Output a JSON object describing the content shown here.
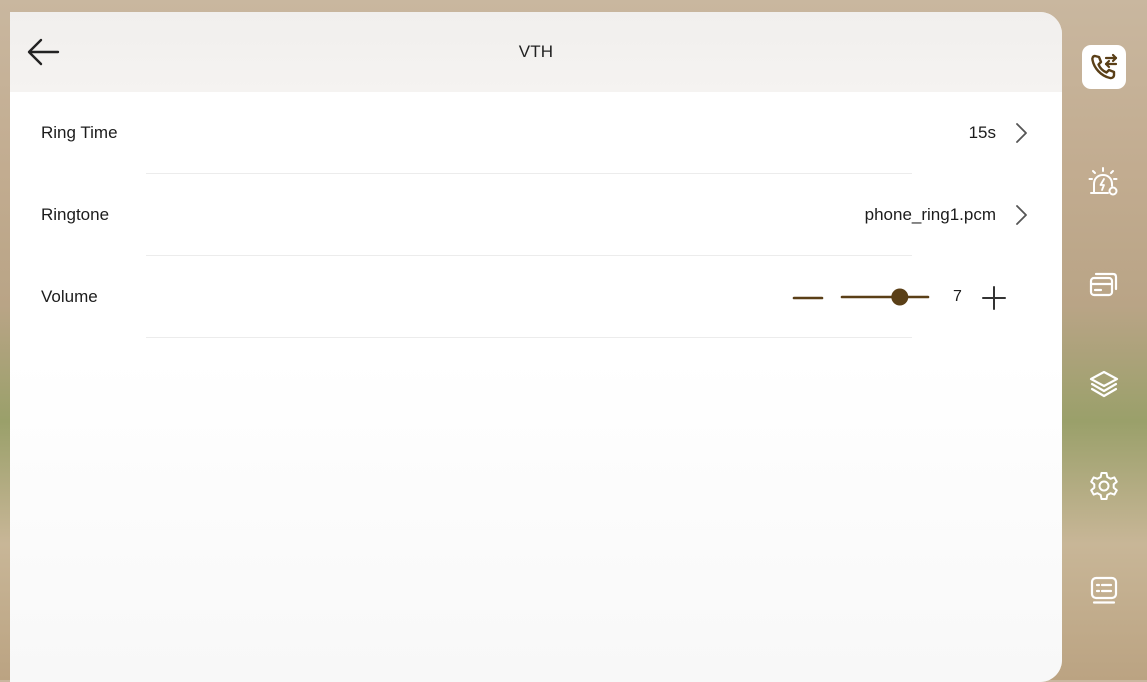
{
  "header": {
    "title": "VTH"
  },
  "settings": {
    "ring_time": {
      "label": "Ring Time",
      "value": "15s"
    },
    "ringtone": {
      "label": "Ringtone",
      "value": "phone_ring1.pcm"
    },
    "volume": {
      "label": "Volume",
      "value": "7",
      "level": 7,
      "max": 10
    }
  },
  "sidebar": {
    "items": [
      {
        "icon": "call-transfer-icon",
        "active": true
      },
      {
        "icon": "alarm-settings-icon",
        "active": false
      },
      {
        "icon": "card-icon",
        "active": false
      },
      {
        "icon": "layers-icon",
        "active": false
      },
      {
        "icon": "gear-icon",
        "active": false
      },
      {
        "icon": "info-list-icon",
        "active": false
      }
    ]
  },
  "colors": {
    "accent": "#6b4a1d",
    "panel": "#ffffff",
    "header": "#f2f0ee"
  }
}
